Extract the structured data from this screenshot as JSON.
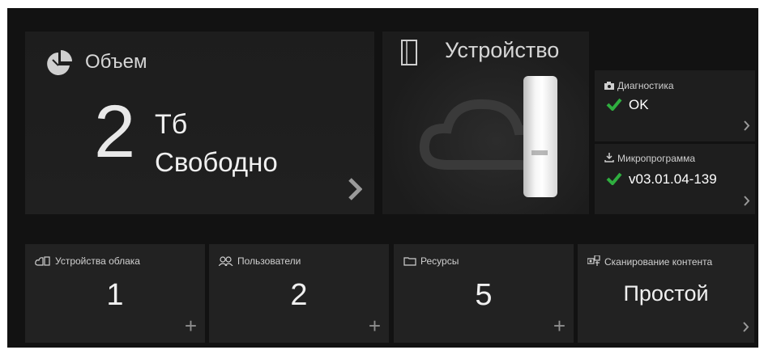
{
  "storage": {
    "title": "Объем",
    "amount": "2",
    "unit": "Тб",
    "label": "Свободно",
    "icon": "pie-chart-icon"
  },
  "device": {
    "title": "Устройство",
    "icon": "device-outline-icon",
    "diagnostics": {
      "label": "Диагностика",
      "status": "OK",
      "icon": "camera-icon"
    },
    "firmware": {
      "label": "Микропрограмма",
      "version": "v03.01.04-139",
      "icon": "download-icon"
    },
    "check_color": "#2fae3f"
  },
  "tiles": [
    {
      "label": "Устройства облака",
      "value": "1",
      "icon": "cloud-device-icon",
      "action": "plus"
    },
    {
      "label": "Пользователи",
      "value": "2",
      "icon": "users-icon",
      "action": "plus"
    },
    {
      "label": "Ресурсы",
      "value": "5",
      "icon": "folder-icon",
      "action": "plus"
    },
    {
      "label": "Сканирование контента",
      "value": "Простой",
      "icon": "content-scan-icon",
      "action": "chevron"
    }
  ]
}
